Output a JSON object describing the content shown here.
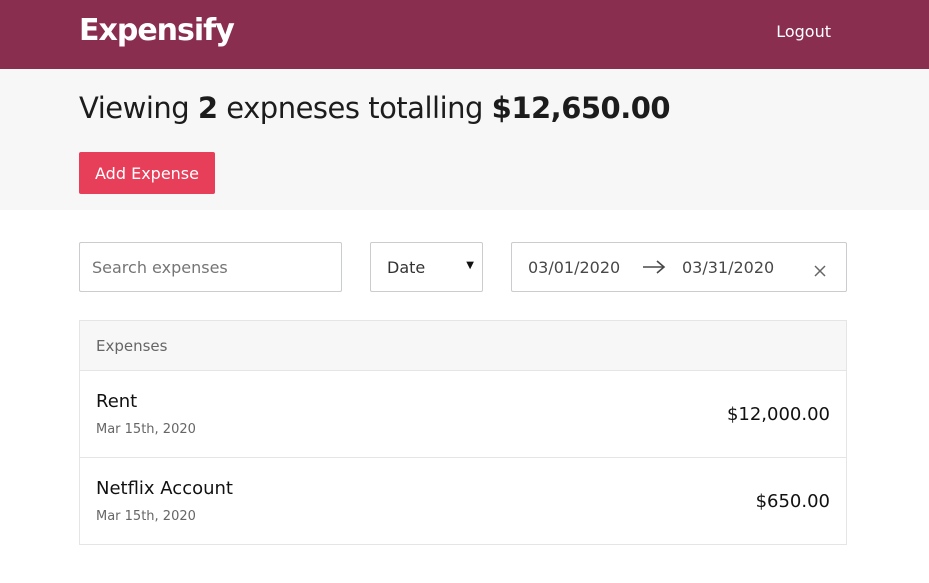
{
  "header": {
    "brand": "Expensify",
    "logout_label": "Logout"
  },
  "summary": {
    "prefix": "Viewing",
    "count": "2",
    "middle": "expneses totalling",
    "total": "$12,650.00",
    "add_label": "Add Expense"
  },
  "filters": {
    "search_placeholder": "Search expenses",
    "search_value": "",
    "sort_selected": "Date",
    "start_date": "03/01/2020",
    "end_date": "03/31/2020"
  },
  "list": {
    "header": "Expenses",
    "items": [
      {
        "description": "Rent",
        "date": "Mar 15th, 2020",
        "amount": "$12,000.00"
      },
      {
        "description": "Netflix Account",
        "date": "Mar 15th, 2020",
        "amount": "$650.00"
      }
    ]
  },
  "colors": {
    "header_bg": "#8a2e4f",
    "add_button_bg": "#e73f5a",
    "summary_bg": "#f7f7f7"
  },
  "icons": {
    "sort_caret": "caret-down-icon",
    "date_arrow": "arrow-right-icon",
    "date_clear": "close-icon"
  }
}
